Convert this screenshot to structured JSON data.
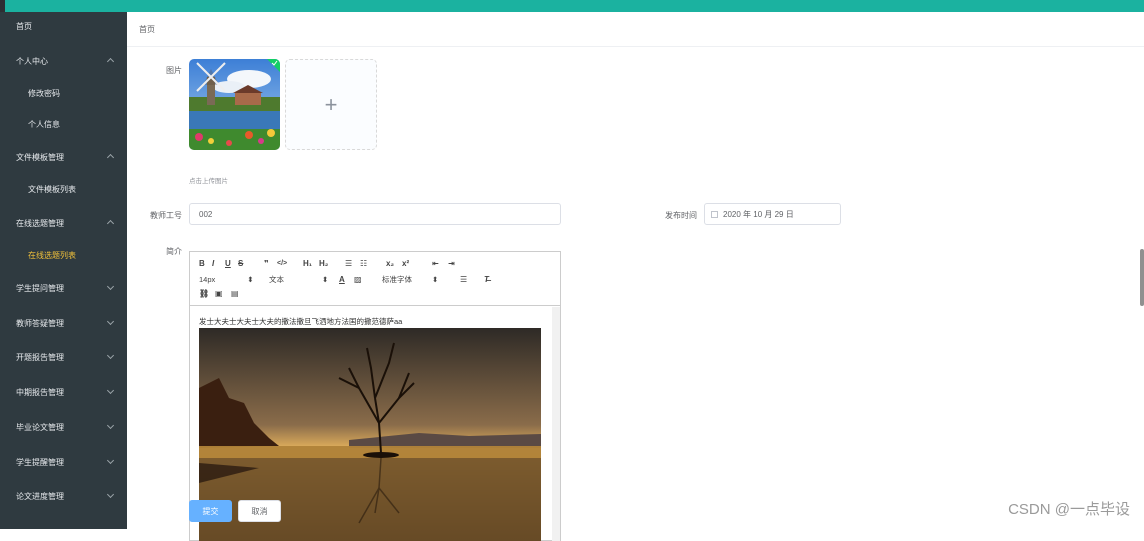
{
  "sidebar": {
    "items": [
      {
        "label": "首页",
        "type": "top",
        "arrow": ""
      },
      {
        "label": "个人中心",
        "type": "top",
        "arrow": "up"
      },
      {
        "label": "修改密码",
        "type": "sub",
        "arrow": ""
      },
      {
        "label": "个人信息",
        "type": "sub",
        "arrow": ""
      },
      {
        "label": "文件模板管理",
        "type": "top",
        "arrow": "up"
      },
      {
        "label": "文件模板列表",
        "type": "sub",
        "arrow": ""
      },
      {
        "label": "在线选题管理",
        "type": "top",
        "arrow": "up"
      },
      {
        "label": "在线选题列表",
        "type": "sub",
        "arrow": "",
        "active": true
      },
      {
        "label": "学生提问管理",
        "type": "top",
        "arrow": "down"
      },
      {
        "label": "教师答疑管理",
        "type": "top",
        "arrow": "down"
      },
      {
        "label": "开题报告管理",
        "type": "top",
        "arrow": "down"
      },
      {
        "label": "中期报告管理",
        "type": "top",
        "arrow": "down"
      },
      {
        "label": "毕业论文管理",
        "type": "top",
        "arrow": "down"
      },
      {
        "label": "学生提醒管理",
        "type": "top",
        "arrow": "down"
      },
      {
        "label": "论文进度管理",
        "type": "top",
        "arrow": "down"
      }
    ]
  },
  "breadcrumb": "首页",
  "form": {
    "image_label": "图片",
    "upload_hint": "点击上传图片",
    "teacher_id_label": "教师工号",
    "teacher_id_value": "002",
    "publish_time_label": "发布时间",
    "publish_time_value": "2020 年 10 月 29 日",
    "intro_label": "简介"
  },
  "editor": {
    "font_size": "14px",
    "text_type": "文本",
    "font_family": "标准字体",
    "content_text": "发士大夫士大夫士大夫的撒法撒旦飞洒地方法国的撒范德萨aa"
  },
  "buttons": {
    "submit": "提交",
    "cancel": "取消"
  },
  "watermark": "CSDN @一点毕设",
  "colors": {
    "topbar": "#1bb2a0",
    "sidebar": "#2f3a40",
    "active_menu": "#f1c13a",
    "primary_button": "#66b1ff"
  }
}
